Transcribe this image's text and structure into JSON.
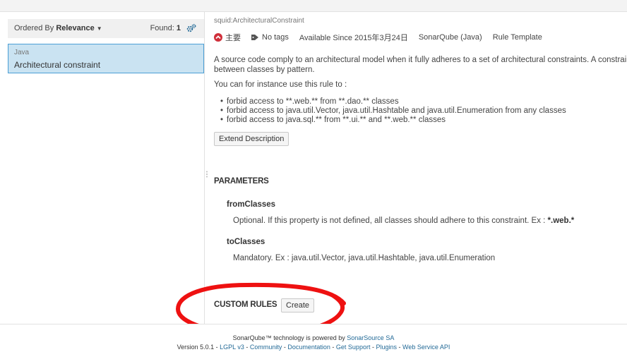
{
  "sidebar": {
    "sort_prefix": "Ordered By",
    "sort_value": "Relevance",
    "found_label": "Found:",
    "found_count": "1",
    "items": [
      {
        "language": "Java",
        "name": "Architectural constraint"
      }
    ]
  },
  "rule": {
    "key": "squid:ArchitecturalConstraint",
    "severity": "主要",
    "severity_color": "#d02f3a",
    "tags": "No tags",
    "available_since": "Available Since 2015年3月24日",
    "repository": "SonarQube (Java)",
    "template": "Rule Template",
    "description": [
      "A source code comply to an architectural model when it fully adheres to a set of architectural constraints. A constrai",
      "between classes by pattern."
    ],
    "instance_intro": "You can for instance use this rule to :",
    "bullets": [
      "forbid access to **.web.** from **.dao.** classes",
      "forbid access to java.util.Vector, java.util.Hashtable and java.util.Enumeration from any classes",
      "forbid access to java.sql.** from **.ui.** and **.web.** classes"
    ],
    "extend_button": "Extend Description"
  },
  "parameters": {
    "title": "PARAMETERS",
    "items": [
      {
        "name": "fromClasses",
        "description": "Optional. If this property is not defined, all classes should adhere to this constraint. Ex : ",
        "example": "*.web.*"
      },
      {
        "name": "toClasses",
        "description": "Mandatory. Ex : java.util.Vector, java.util.Hashtable, java.util.Enumeration"
      }
    ]
  },
  "custom_rules": {
    "title": "CUSTOM RULES",
    "create_button": "Create",
    "annotation_color": "#ee1111"
  },
  "footer": {
    "powered_prefix": "SonarQube™ technology is powered by",
    "powered_link": "SonarSource SA",
    "version": "Version 5.0.1",
    "links": [
      "LGPL v3",
      "Community",
      "Documentation",
      "Get Support",
      "Plugins",
      "Web Service API"
    ]
  },
  "icons": {
    "severity": "major-severity-icon",
    "tags": "tag-icon",
    "settings": "gear-icon",
    "grip": "drag-handle-icon"
  }
}
